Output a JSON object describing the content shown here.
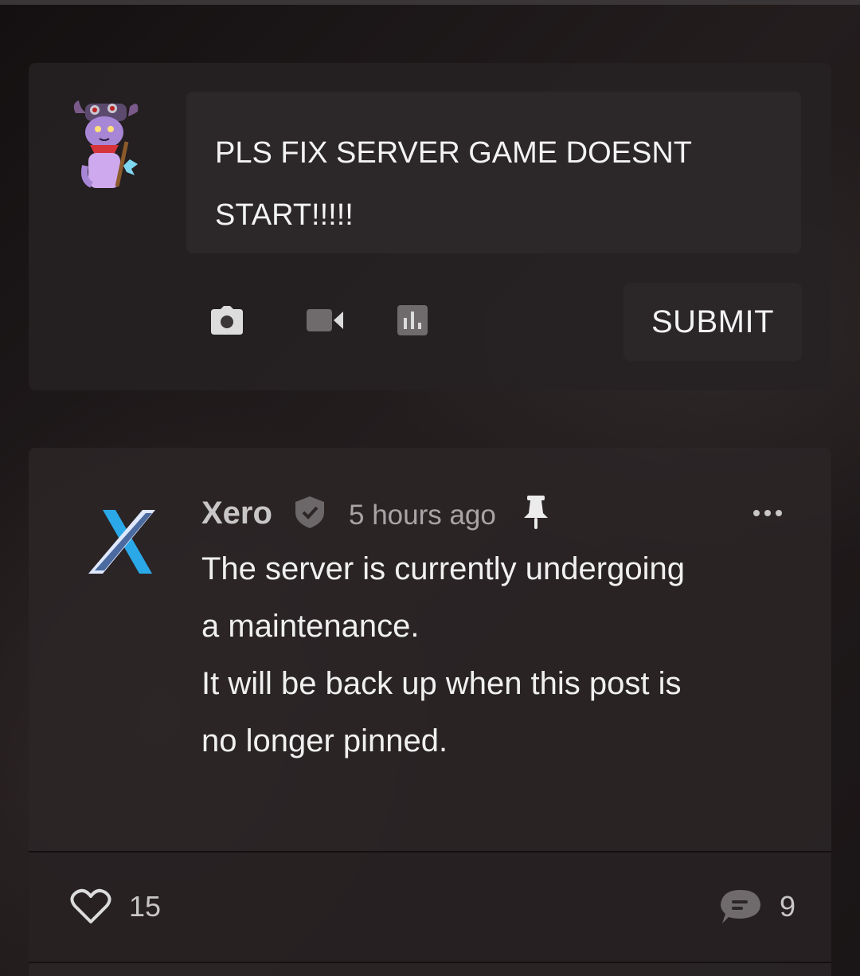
{
  "composer": {
    "draft_text": "PLS FIX SERVER GAME DOESNT START!!!!!",
    "tools": [
      "camera-icon",
      "video-icon",
      "poll-icon"
    ],
    "submit_label": "SUBMIT"
  },
  "post": {
    "author": "Xero",
    "verified": true,
    "timestamp": "5 hours ago",
    "pinned": true,
    "body_lines": [
      "The server is currently undergoing",
      "a maintenance.",
      "It will be back up when this post is",
      "no longer pinned."
    ],
    "likes": "15",
    "comments": "9"
  },
  "colors": {
    "accent_x_light": "#dfe8ff",
    "accent_x_blue": "#2aa8e8",
    "text_primary": "#f3f3f3",
    "text_muted": "#a9a5a6"
  }
}
